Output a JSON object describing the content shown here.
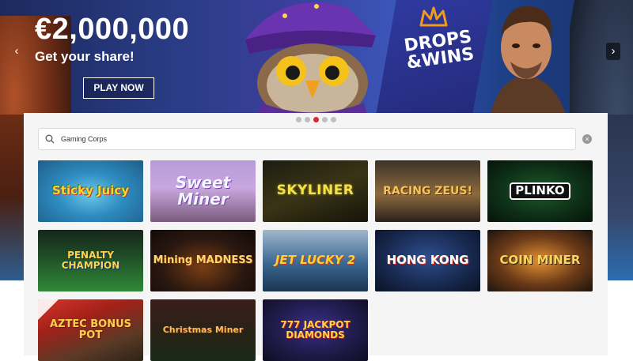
{
  "hero": {
    "title": "€2,000,000",
    "subtitle": "Get your share!",
    "cta_label": "PLAY NOW",
    "promo_line1": "DROPS",
    "promo_line2": "&WINS",
    "arrow_prev": "‹",
    "arrow_next": "›"
  },
  "carousel": {
    "slide_count": 5,
    "active_index": 2
  },
  "search": {
    "value": "Gaming Corps",
    "clear_label": "×"
  },
  "games": [
    {
      "title": "Sticky Juicy"
    },
    {
      "title": "Sweet Miner"
    },
    {
      "title": "SKYLINER"
    },
    {
      "title": "RACING ZEUS!"
    },
    {
      "title": "PLINKO"
    },
    {
      "title": "PENALTY CHAMPION"
    },
    {
      "title": "Mining MADNESS"
    },
    {
      "title": "JET LUCKY 2"
    },
    {
      "title": "HONG KONG"
    },
    {
      "title": "COIN MINER"
    },
    {
      "title": "AZTEC BONUS POT"
    },
    {
      "title": "Christmas Miner"
    },
    {
      "title": "777 JACKPOT DIAMONDS"
    }
  ],
  "colors": {
    "accent": "#d52b2b",
    "panel_bg": "#f5f5f5",
    "hero_bg": "#2a3c86"
  }
}
